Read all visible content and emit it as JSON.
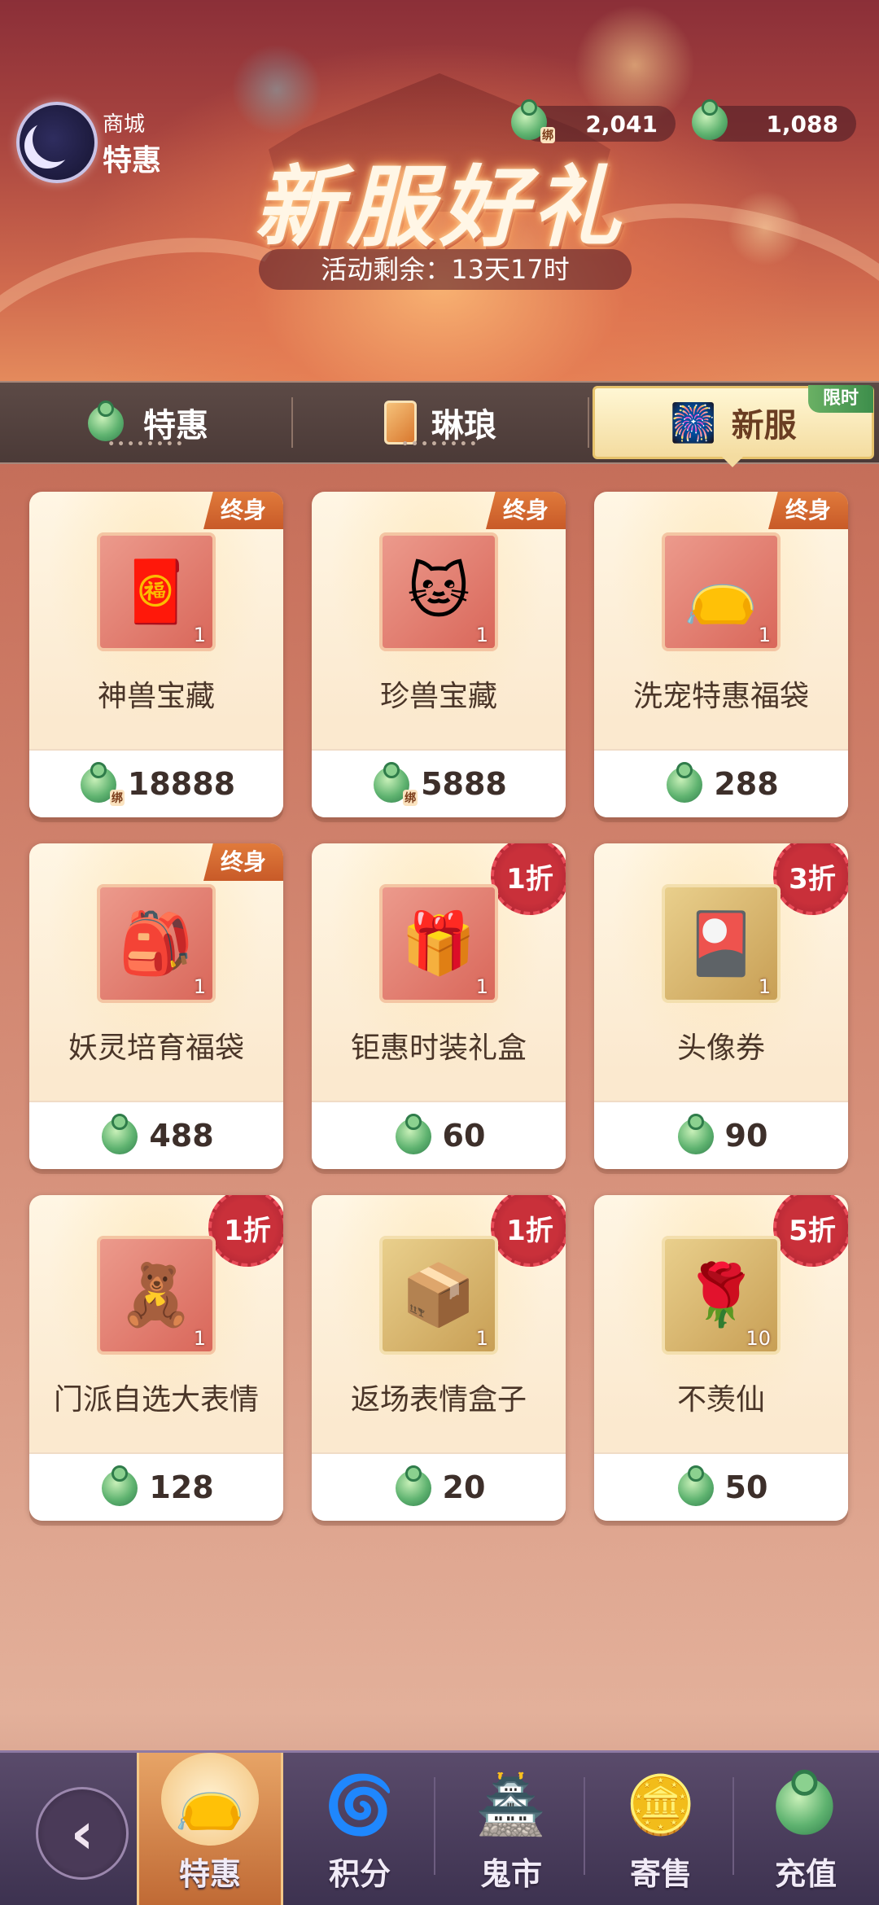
{
  "header": {
    "shop_sub": "商城",
    "shop_title": "特惠",
    "currency_bound": "2,041",
    "currency_main": "1,088",
    "bind_mark": "绑",
    "banner_title": "新服好礼",
    "countdown": "活动剩余：13天17时"
  },
  "tabs": [
    {
      "label": "特惠",
      "icon": "jade-coin-icon"
    },
    {
      "label": "琳琅",
      "icon": "card-icon"
    },
    {
      "label": "新服",
      "icon": "firework-rocket-icon",
      "badge": "限时"
    }
  ],
  "items": [
    {
      "name": "神兽宝藏",
      "qty": "1",
      "price": "18888",
      "tag": "终身",
      "tag_type": "lifetime",
      "coin": "bound",
      "glyph": "🧧"
    },
    {
      "name": "珍兽宝藏",
      "qty": "1",
      "price": "5888",
      "tag": "终身",
      "tag_type": "lifetime",
      "coin": "bound",
      "glyph": "🐱"
    },
    {
      "name": "洗宠特惠福袋",
      "qty": "1",
      "price": "288",
      "tag": "终身",
      "tag_type": "lifetime",
      "coin": "main",
      "glyph": "👝"
    },
    {
      "name": "妖灵培育福袋",
      "qty": "1",
      "price": "488",
      "tag": "终身",
      "tag_type": "lifetime",
      "coin": "main",
      "glyph": "🎒"
    },
    {
      "name": "钜惠时装礼盒",
      "qty": "1",
      "price": "60",
      "tag": "1折",
      "tag_type": "discount",
      "coin": "main",
      "glyph": "🎁"
    },
    {
      "name": "头像券",
      "qty": "1",
      "price": "90",
      "tag": "3折",
      "tag_type": "discount",
      "coin": "main",
      "glyph": "🎴"
    },
    {
      "name": "门派自选大表情",
      "qty": "1",
      "price": "128",
      "tag": "1折",
      "tag_type": "discount",
      "coin": "main",
      "glyph": "🧸"
    },
    {
      "name": "返场表情盒子",
      "qty": "1",
      "price": "20",
      "tag": "1折",
      "tag_type": "discount",
      "coin": "main",
      "glyph": "📦"
    },
    {
      "name": "不羡仙",
      "qty": "10",
      "price": "50",
      "tag": "5折",
      "tag_type": "discount",
      "coin": "main",
      "glyph": "🌹"
    }
  ],
  "bottom_nav": [
    {
      "label": "特惠",
      "icon": "lucky-bag-icon",
      "active": true
    },
    {
      "label": "积分",
      "icon": "swirl-icon",
      "active": false
    },
    {
      "label": "鬼市",
      "icon": "market-house-icon",
      "active": false
    },
    {
      "label": "寄售",
      "icon": "gold-ingot-icon",
      "active": false
    },
    {
      "label": "充值",
      "icon": "jade-coin-icon",
      "active": false
    }
  ],
  "colors": {
    "accent": "#e07a3b",
    "discount": "#c9303a",
    "jade": "#5fb370",
    "tab_active": "#fff7d4"
  }
}
